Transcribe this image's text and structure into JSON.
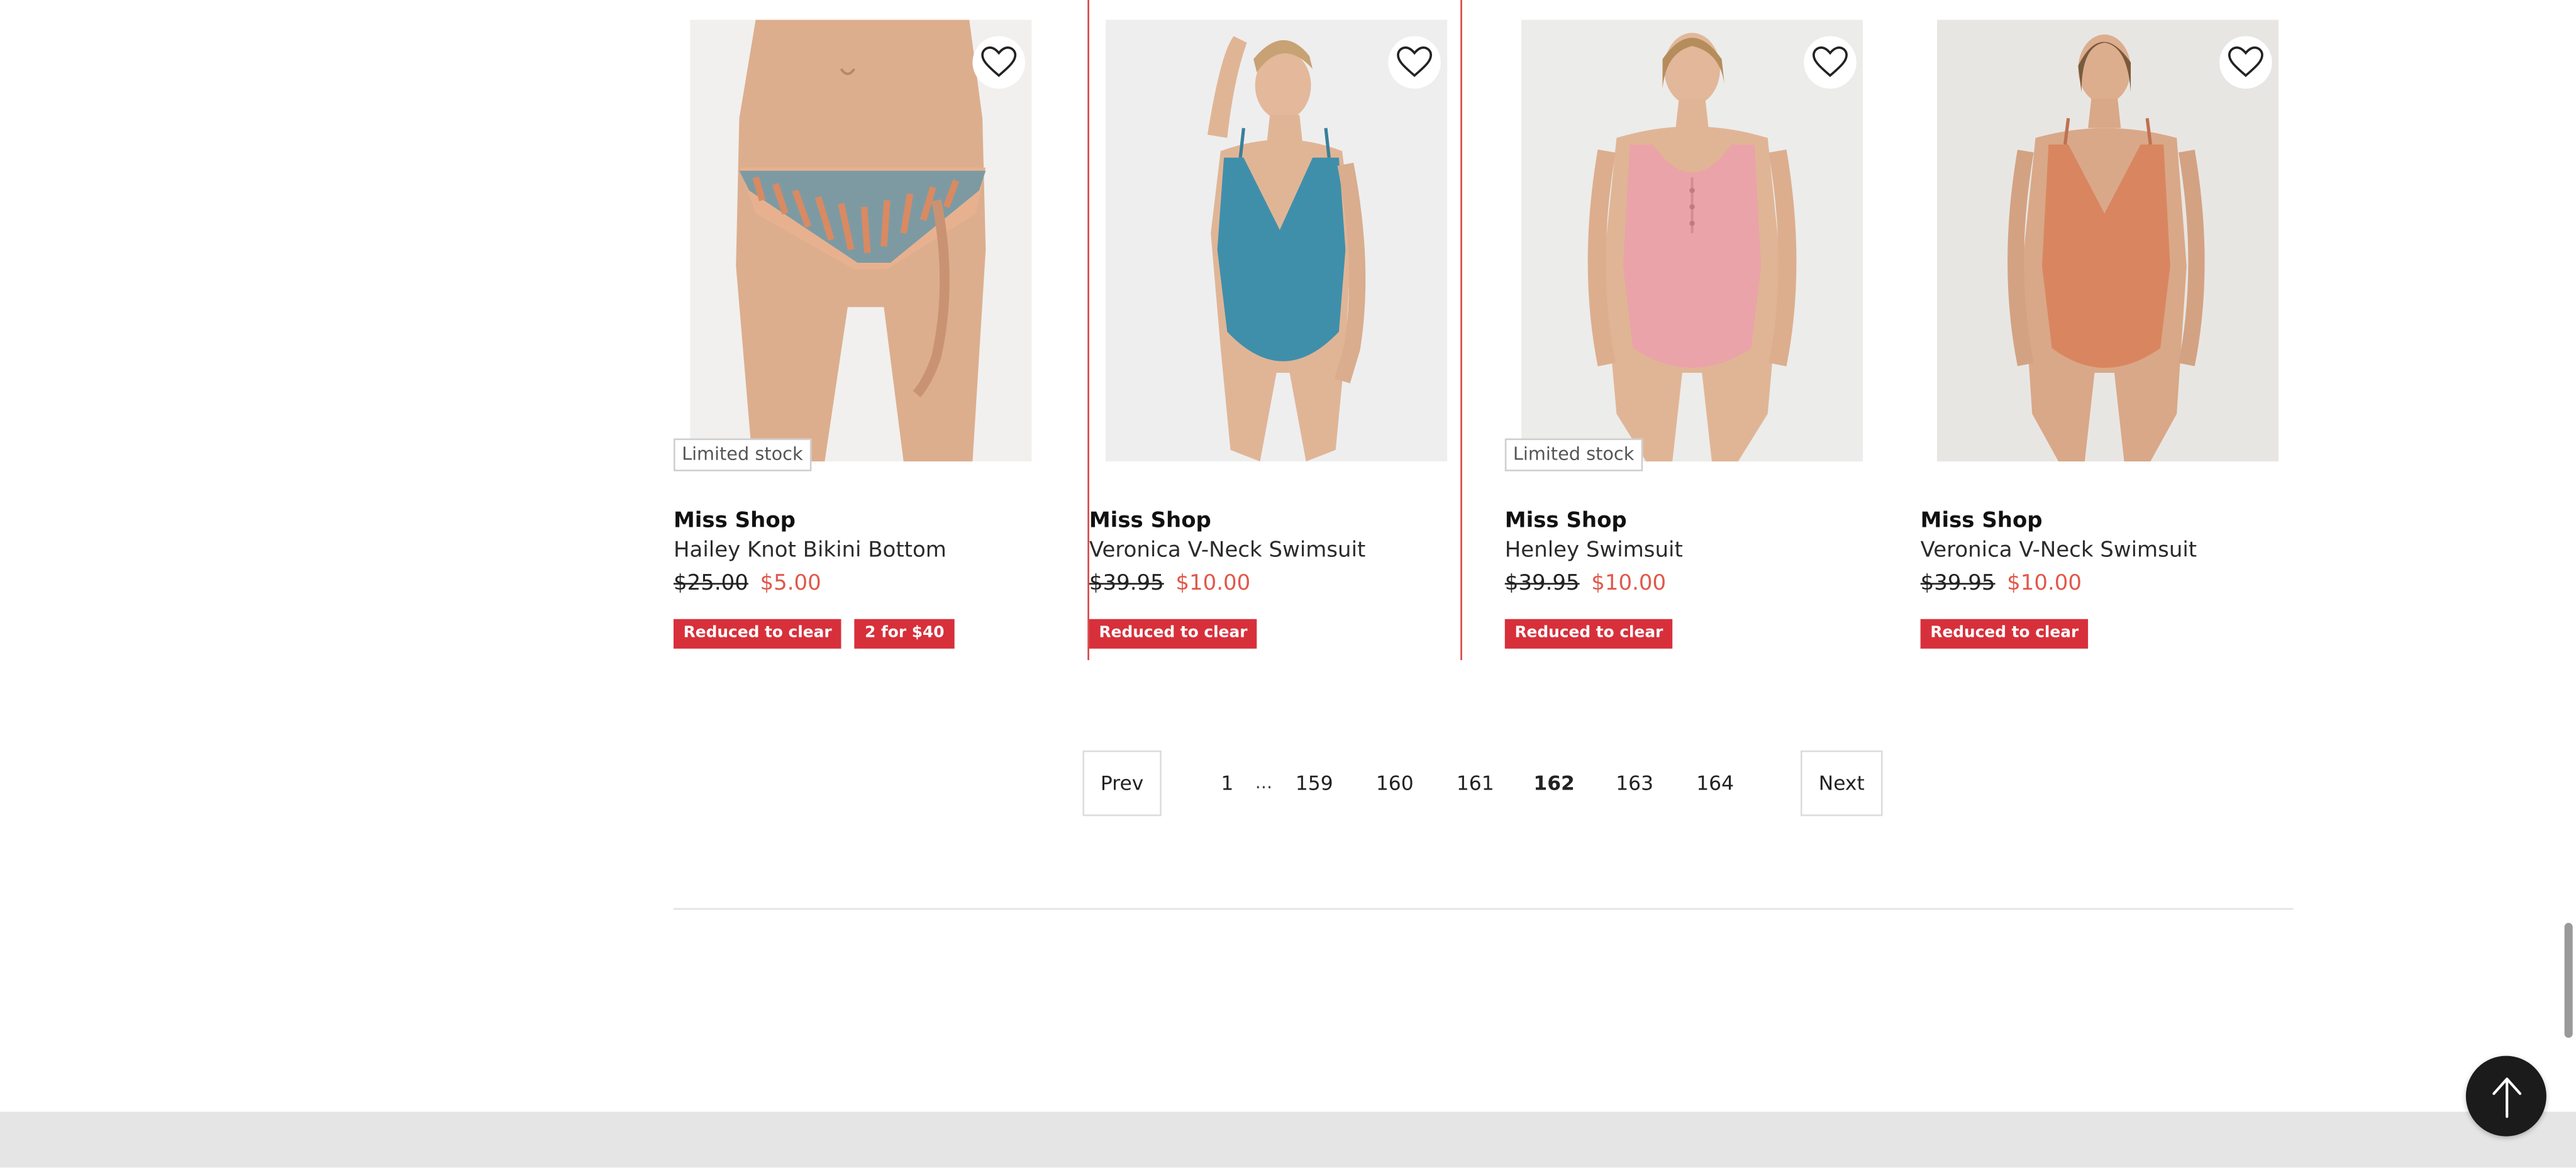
{
  "products": [
    {
      "brand": "Miss Shop",
      "name": "Hailey Knot Bikini Bottom",
      "was_price": "$25.00",
      "sale_price": "$5.00",
      "stock_label": "Limited stock",
      "badges": [
        "Reduced to clear",
        "2 for $40"
      ],
      "image": "striped bikini bottom model"
    },
    {
      "brand": "Miss Shop",
      "name": "Veronica V-Neck Swimsuit",
      "was_price": "$39.95",
      "sale_price": "$10.00",
      "stock_label": "",
      "badges": [
        "Reduced to clear"
      ],
      "image": "teal one-piece swimsuit model"
    },
    {
      "brand": "Miss Shop",
      "name": "Henley Swimsuit",
      "was_price": "$39.95",
      "sale_price": "$10.00",
      "stock_label": "Limited stock",
      "badges": [
        "Reduced to clear"
      ],
      "image": "pink henley one-piece swimsuit model"
    },
    {
      "brand": "Miss Shop",
      "name": "Veronica V-Neck Swimsuit",
      "was_price": "$39.95",
      "sale_price": "$10.00",
      "stock_label": "",
      "badges": [
        "Reduced to clear"
      ],
      "image": "terracotta one-piece swimsuit model"
    }
  ],
  "pagination": {
    "prev_label": "Prev",
    "next_label": "Next",
    "first": "1",
    "ellipsis": "...",
    "pages": [
      "159",
      "160",
      "161",
      "162",
      "163",
      "164"
    ],
    "current": "162"
  },
  "icons": {
    "wishlist": "heart-outline-icon",
    "back_to_top": "arrow-up-icon"
  },
  "colors": {
    "sale_price": "#e0584a",
    "badge_bg": "#d7303b",
    "selection_outline": "#d64545",
    "footer_band": "#e5e5e5",
    "back_to_top_bg": "#1b1b1b"
  }
}
